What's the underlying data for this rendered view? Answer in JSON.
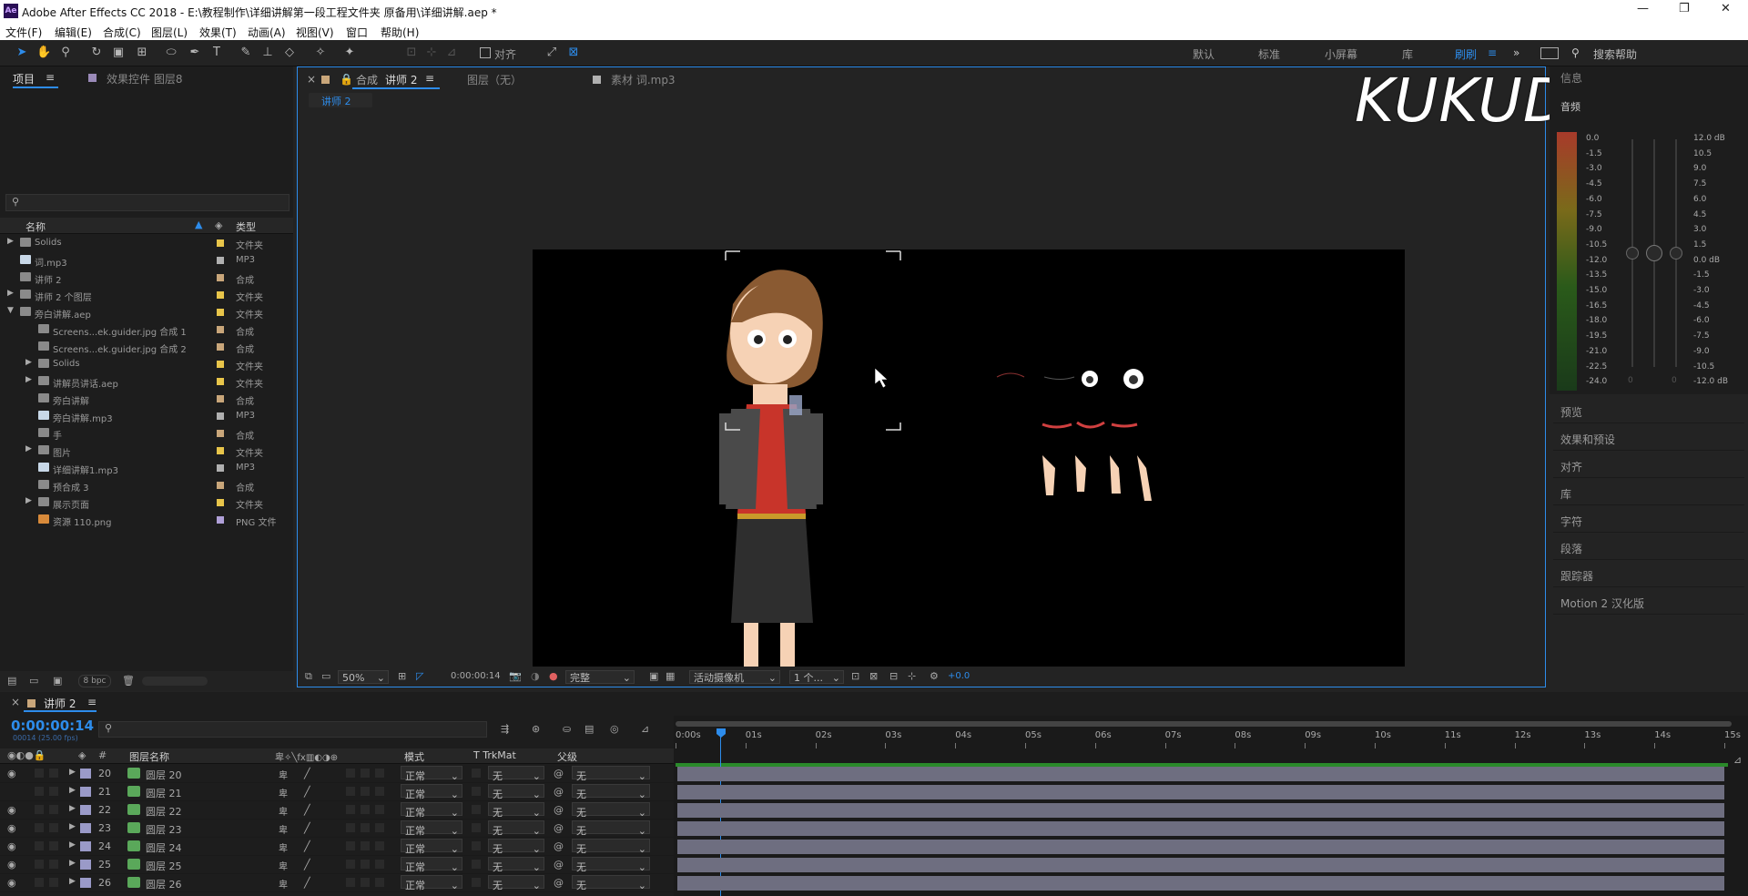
{
  "titlebar": {
    "app_icon": "Ae",
    "title": "Adobe After Effects CC 2018 - E:\\教程制作\\详细讲解第一段工程文件夹 原备用\\详细讲解.aep *",
    "minimize": "—",
    "maximize": "❐",
    "close": "✕"
  },
  "menu": [
    "文件(F)",
    "编辑(E)",
    "合成(C)",
    "图层(L)",
    "效果(T)",
    "动画(A)",
    "视图(V)",
    "窗口",
    "帮助(H)"
  ],
  "toolbar": {
    "snap_label": "对齐",
    "workspaces": [
      "默认",
      "标准",
      "小屏幕",
      "库",
      "刷刷"
    ],
    "search_placeholder": "搜索帮助"
  },
  "project_panel": {
    "tab_project": "项目",
    "tab_effects": "效果控件 图层8",
    "search_placeholder": "",
    "col_name": "名称",
    "col_type": "类型",
    "items": [
      {
        "name": "Solids",
        "type": "文件夹",
        "color": "#e8c54a",
        "indent": 0,
        "kind": "folder"
      },
      {
        "name": "词.mp3",
        "type": "MP3",
        "color": "#b0b0b0",
        "indent": 0,
        "kind": "audio"
      },
      {
        "name": "讲师 2",
        "type": "合成",
        "color": "#c9a67a",
        "indent": 0,
        "kind": "comp"
      },
      {
        "name": "讲师 2 个图层",
        "type": "文件夹",
        "color": "#e8c54a",
        "indent": 0,
        "kind": "folder"
      },
      {
        "name": "旁白讲解.aep",
        "type": "文件夹",
        "color": "#e8c54a",
        "indent": 0,
        "kind": "folder-open"
      },
      {
        "name": "Screens...ek.guider.jpg 合成 1",
        "type": "合成",
        "color": "#c9a67a",
        "indent": 1,
        "kind": "comp"
      },
      {
        "name": "Screens...ek.guider.jpg 合成 2",
        "type": "合成",
        "color": "#c9a67a",
        "indent": 1,
        "kind": "comp"
      },
      {
        "name": "Solids",
        "type": "文件夹",
        "color": "#e8c54a",
        "indent": 1,
        "kind": "folder"
      },
      {
        "name": "讲解员讲话.aep",
        "type": "文件夹",
        "color": "#e8c54a",
        "indent": 1,
        "kind": "folder"
      },
      {
        "name": "旁白讲解",
        "type": "合成",
        "color": "#c9a67a",
        "indent": 1,
        "kind": "comp"
      },
      {
        "name": "旁白讲解.mp3",
        "type": "MP3",
        "color": "#b0b0b0",
        "indent": 1,
        "kind": "audio"
      },
      {
        "name": "手",
        "type": "合成",
        "color": "#c9a67a",
        "indent": 1,
        "kind": "comp"
      },
      {
        "name": "图片",
        "type": "文件夹",
        "color": "#e8c54a",
        "indent": 1,
        "kind": "folder"
      },
      {
        "name": "详细讲解1.mp3",
        "type": "MP3",
        "color": "#b0b0b0",
        "indent": 1,
        "kind": "audio"
      },
      {
        "name": "预合成 3",
        "type": "合成",
        "color": "#c9a67a",
        "indent": 1,
        "kind": "comp"
      },
      {
        "name": "展示页面",
        "type": "文件夹",
        "color": "#e8c54a",
        "indent": 1,
        "kind": "folder"
      },
      {
        "name": "资源 110.png",
        "type": "PNG 文件",
        "color": "#b0a0d8",
        "indent": 1,
        "kind": "image"
      }
    ],
    "bpc": "8 bpc"
  },
  "comp_panel": {
    "tab_comp_prefix": "合成",
    "tab_comp_name": "讲师 2",
    "tab_layer": "图层（无）",
    "tab_footage": "素材 词.mp3",
    "subtab": "讲师 2",
    "zoom": "50%",
    "timecode": "0:00:00:14",
    "resolution": "完整",
    "camera": "活动摄像机",
    "views": "1 个...",
    "exposure": "+0.0"
  },
  "watermark": "KUKUDEHE",
  "audio_panel": {
    "title_top": "信息",
    "title_audio": "音频",
    "left_scale": [
      "0.0",
      "-1.5",
      "-3.0",
      "-4.5",
      "-6.0",
      "-7.5",
      "-9.0",
      "-10.5",
      "-12.0",
      "-13.5",
      "-15.0",
      "-16.5",
      "-18.0",
      "-19.5",
      "-21.0",
      "-22.5",
      "-24.0"
    ],
    "right_scale": [
      "12.0 dB",
      "10.5",
      "9.0",
      "7.5",
      "6.0",
      "4.5",
      "3.0",
      "1.5",
      "0.0 dB",
      "-1.5",
      "-3.0",
      "-4.5",
      "-6.0",
      "-7.5",
      "-9.0",
      "-10.5",
      "-12.0 dB"
    ],
    "zero_left": "0",
    "zero_right": "0"
  },
  "right_panel": {
    "items": [
      "预览",
      "效果和预设",
      "对齐",
      "库",
      "字符",
      "段落",
      "跟踪器",
      "Motion 2 汉化版"
    ]
  },
  "timeline": {
    "tab": "讲师 2",
    "timecode": "0:00:00:14",
    "fps": "00014 (25.00 fps)",
    "col_layer_name": "图层名称",
    "col_mode": "模式",
    "col_trk": "T TrkMat",
    "col_parent": "父级",
    "ruler": [
      "0:00s",
      "01s",
      "02s",
      "03s",
      "04s",
      "05s",
      "06s",
      "07s",
      "08s",
      "09s",
      "10s",
      "11s",
      "12s",
      "13s",
      "14s",
      "15s"
    ],
    "layers": [
      {
        "num": "20",
        "name": "圆层 20",
        "mode": "正常",
        "trk": "无",
        "parent": "无"
      },
      {
        "num": "21",
        "name": "圆层 21",
        "mode": "正常",
        "trk": "无",
        "parent": "无"
      },
      {
        "num": "22",
        "name": "圆层 22",
        "mode": "正常",
        "trk": "无",
        "parent": "无"
      },
      {
        "num": "23",
        "name": "圆层 23",
        "mode": "正常",
        "trk": "无",
        "parent": "无"
      },
      {
        "num": "24",
        "name": "圆层 24",
        "mode": "正常",
        "trk": "无",
        "parent": "无"
      },
      {
        "num": "25",
        "name": "圆层 25",
        "mode": "正常",
        "trk": "无",
        "parent": "无"
      },
      {
        "num": "26",
        "name": "圆层 26",
        "mode": "正常",
        "trk": "无",
        "parent": "无"
      }
    ]
  },
  "colors": {
    "accent": "#2d8ceb",
    "panel": "#1d1d1d",
    "bg": "#232323",
    "layer_bar": "#6e6e80"
  }
}
